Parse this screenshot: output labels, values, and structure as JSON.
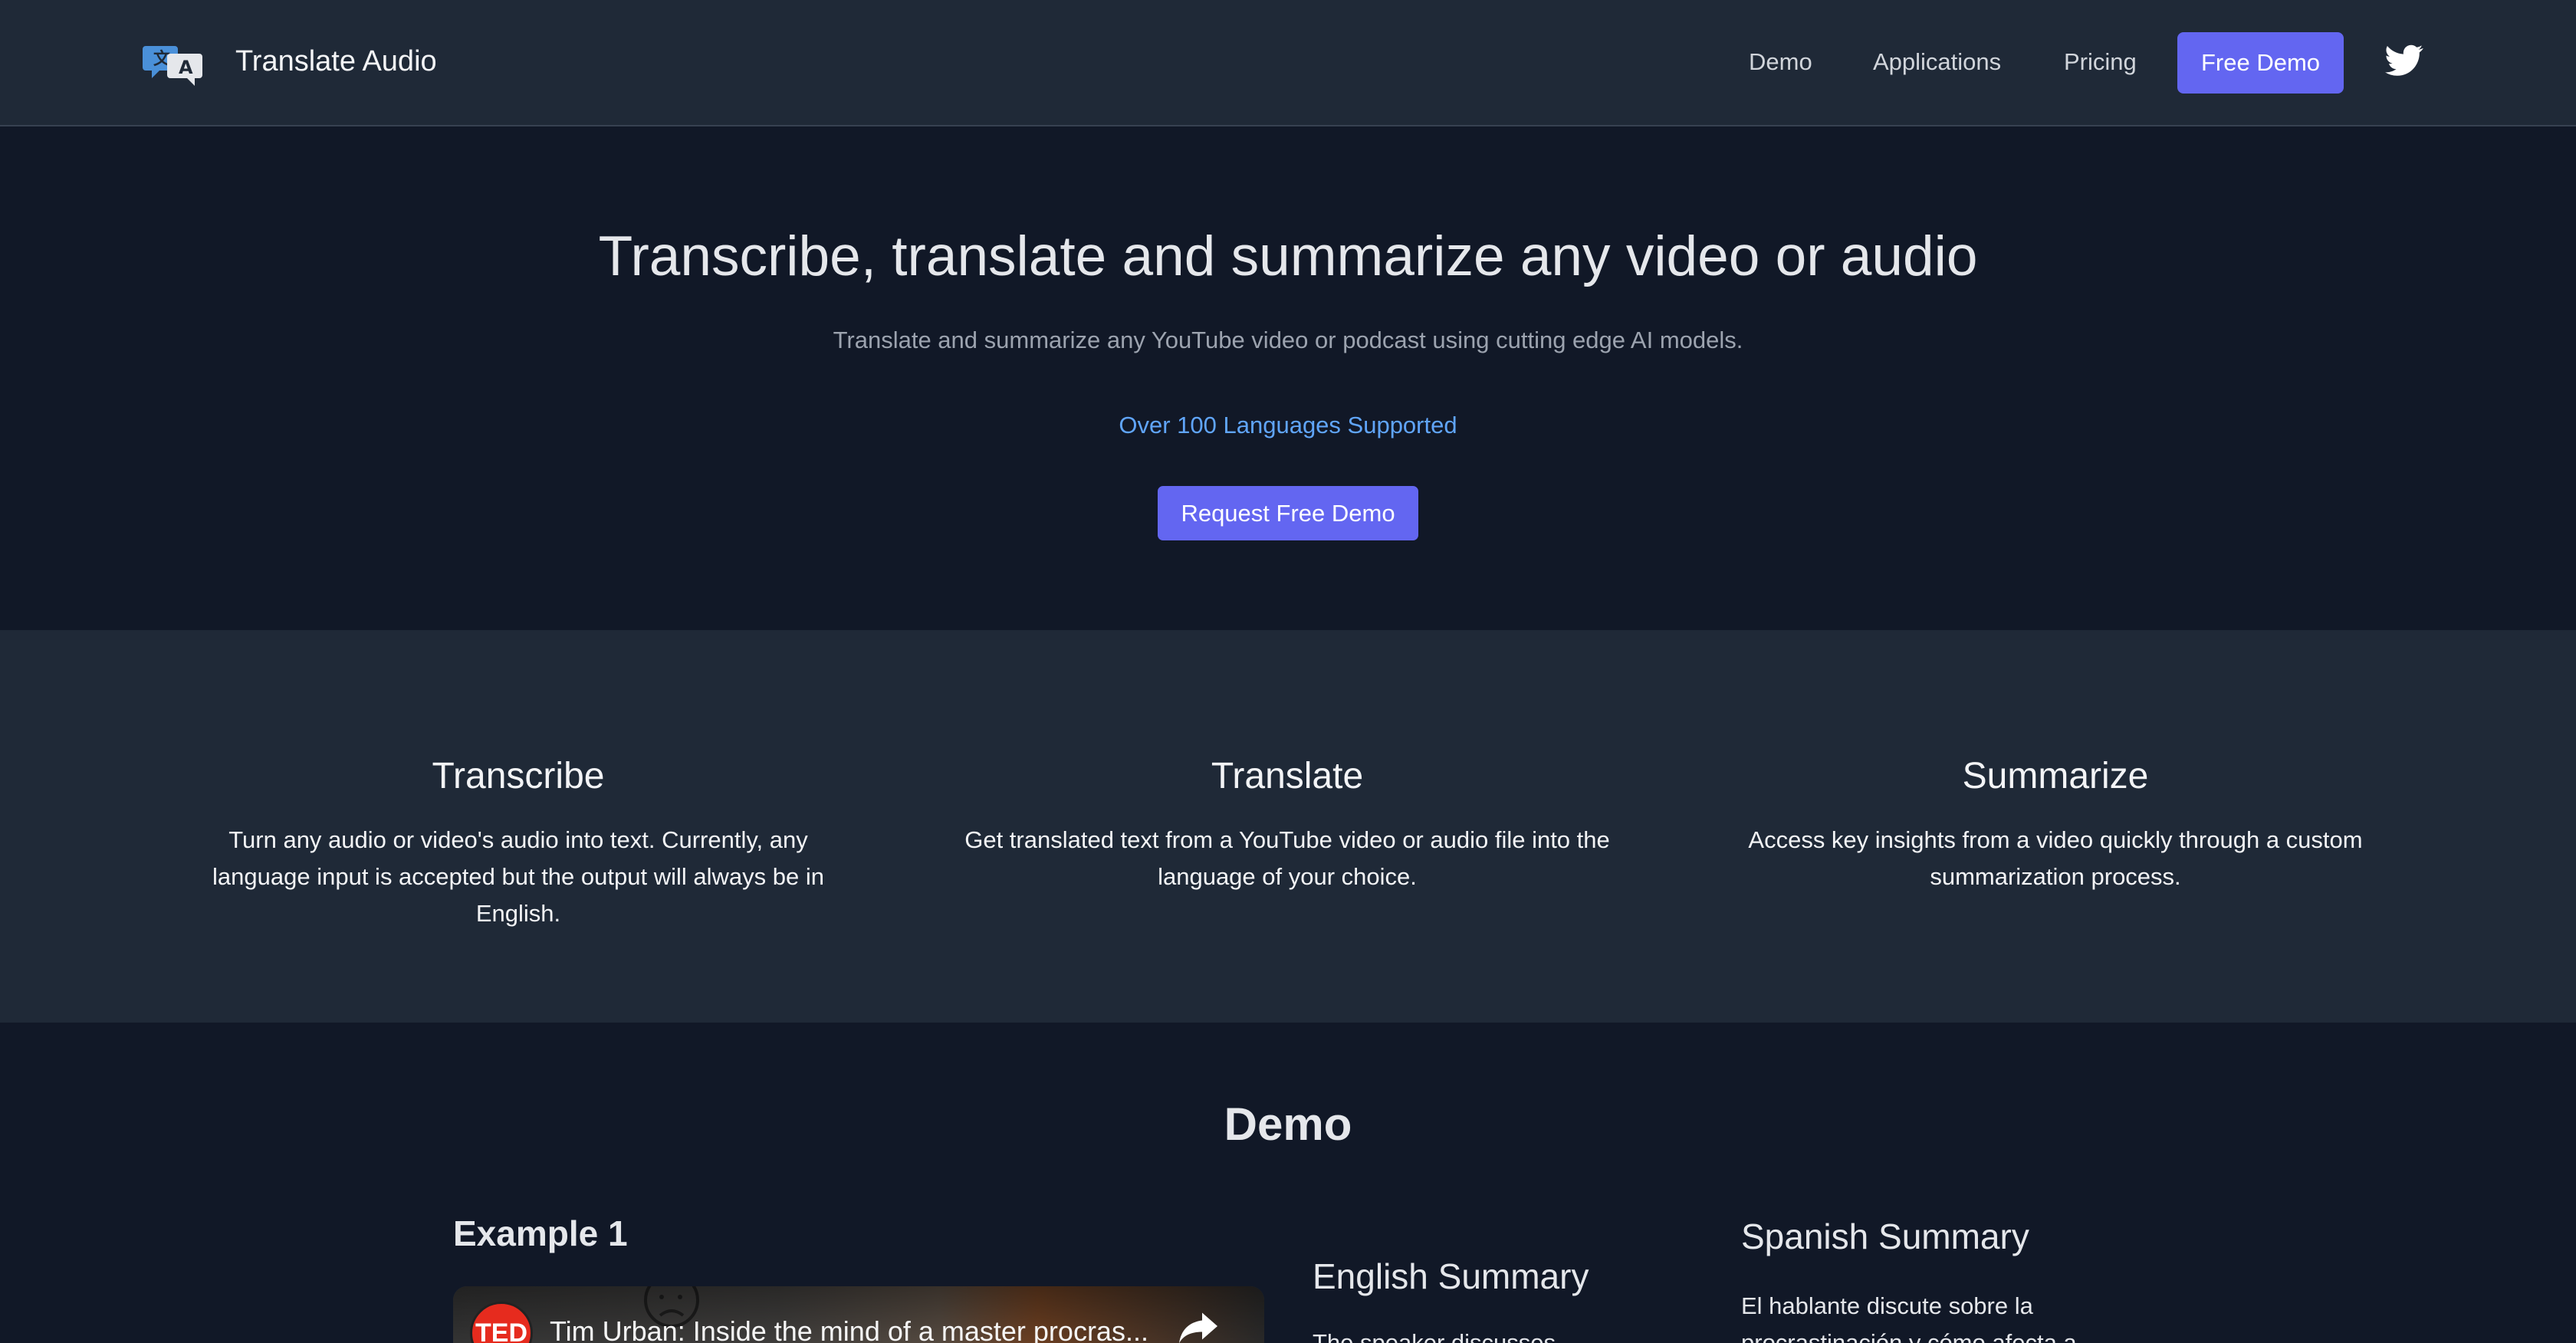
{
  "header": {
    "brand": "Translate Audio",
    "logo_icon": "translate-icon",
    "nav": {
      "demo": "Demo",
      "applications": "Applications",
      "pricing": "Pricing",
      "cta": "Free Demo"
    },
    "social_icon": "twitter-icon"
  },
  "hero": {
    "title": "Transcribe, translate and summarize any video or audio",
    "subtitle": "Translate and summarize any YouTube video or podcast using cutting edge AI models.",
    "languages": "Over 100 Languages Supported",
    "button": "Request Free Demo"
  },
  "features": [
    {
      "title": "Transcribe",
      "description": "Turn any audio or video's audio into text. Currently, any language input is accepted but the output will always be in English."
    },
    {
      "title": "Translate",
      "description": "Get translated text from a YouTube video or audio file into the language of your choice."
    },
    {
      "title": "Summarize",
      "description": "Access key insights from a video quickly through a custom summarization process."
    }
  ],
  "demo": {
    "title": "Demo",
    "example_title": "Example 1",
    "video": {
      "channel_badge": "TED",
      "title": "Tim Urban: Inside the mind of a master procras...",
      "share_icon": "share-icon"
    },
    "english_summary": {
      "title": "English Summary",
      "text": "The speaker discusses"
    },
    "spanish_summary": {
      "title": "Spanish Summary",
      "text": "El hablante discute sobre la procrastinación y cómo afecta a"
    }
  },
  "colors": {
    "header_bg": "#1f2937",
    "page_bg": "#111827",
    "accent": "#6366f1",
    "link_blue": "#60a5fa"
  }
}
